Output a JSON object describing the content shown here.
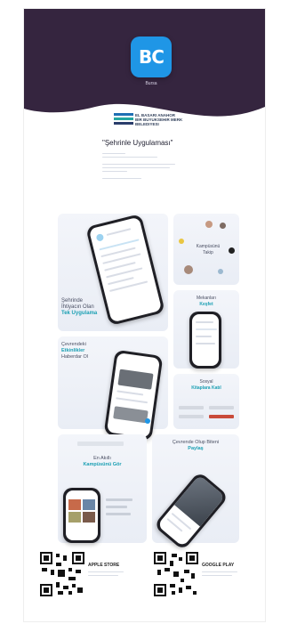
{
  "brand": {
    "logo_text": "BC",
    "logo_caption": "Bursa",
    "primary_color": "#1f96e6",
    "hero_color": "#35253f"
  },
  "org": {
    "name_lines": [
      "EL BASARI ANAHOR",
      "BIR BUYUKSEHIR MERK",
      "BELEDIYESI"
    ]
  },
  "headline": "\"Şehrinle Uygulaması\"",
  "collage": {
    "panel1": {
      "line1": "Şehrinde",
      "line2": "İhtiyacın Olan",
      "line3": "Tek Uygulama"
    },
    "panel2": {
      "line1": "Kampüsünü",
      "line2": "Takip"
    },
    "panel3": {
      "line1": "Mekanları",
      "line2": "Keşfet"
    },
    "panel4": {
      "line1": "Çevrendeki",
      "line2": "Etkinlikler",
      "line3": "Haberdar Ol"
    },
    "panel5": {
      "line1": "Sosyal",
      "line2": "Kitaplara Katıl"
    },
    "panel6": {
      "line1": "En Akıllı",
      "line2": "Kampüsünü Gör"
    },
    "panel7": {
      "line1": "Çevrende Olup Biteni",
      "line2": "Paylaş"
    }
  },
  "stores": {
    "apple_title": "APPLE STORE",
    "google_title": "GOOGLE PLAY"
  }
}
